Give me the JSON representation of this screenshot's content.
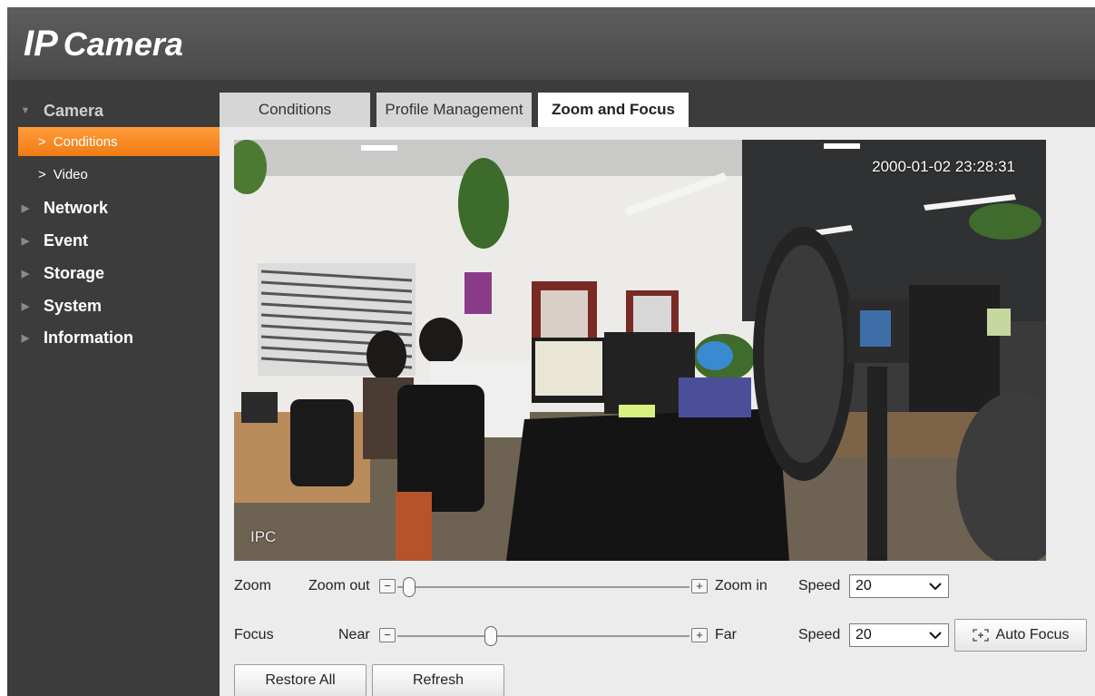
{
  "header": {
    "title_ip": "IP",
    "title_camera": "Camera"
  },
  "sidebar": {
    "items": [
      {
        "label": "Camera",
        "expanded": true
      },
      {
        "label": "Conditions",
        "active": true
      },
      {
        "label": "Video"
      },
      {
        "label": "Network"
      },
      {
        "label": "Event"
      },
      {
        "label": "Storage"
      },
      {
        "label": "System"
      },
      {
        "label": "Information"
      }
    ]
  },
  "tabs": [
    {
      "label": "Conditions"
    },
    {
      "label": "Profile Management"
    },
    {
      "label": "Zoom and Focus",
      "active": true
    }
  ],
  "video": {
    "timestamp": "2000-01-02 23:28:31",
    "osd": "IPC"
  },
  "zoom": {
    "label": "Zoom",
    "out_label": "Zoom out",
    "in_label": "Zoom in",
    "speed_label": "Speed",
    "speed_value": "20",
    "level": 0.04
  },
  "focus": {
    "label": "Focus",
    "near_label": "Near",
    "far_label": "Far",
    "speed_label": "Speed",
    "speed_value": "20",
    "level": 0.32,
    "auto_focus_label": "Auto Focus"
  },
  "buttons": {
    "restore_all": "Restore All",
    "refresh": "Refresh"
  },
  "colors": {
    "accent": "#f28a22",
    "sidebar_bg": "#3c3c3c",
    "header_bg": "#555555"
  }
}
